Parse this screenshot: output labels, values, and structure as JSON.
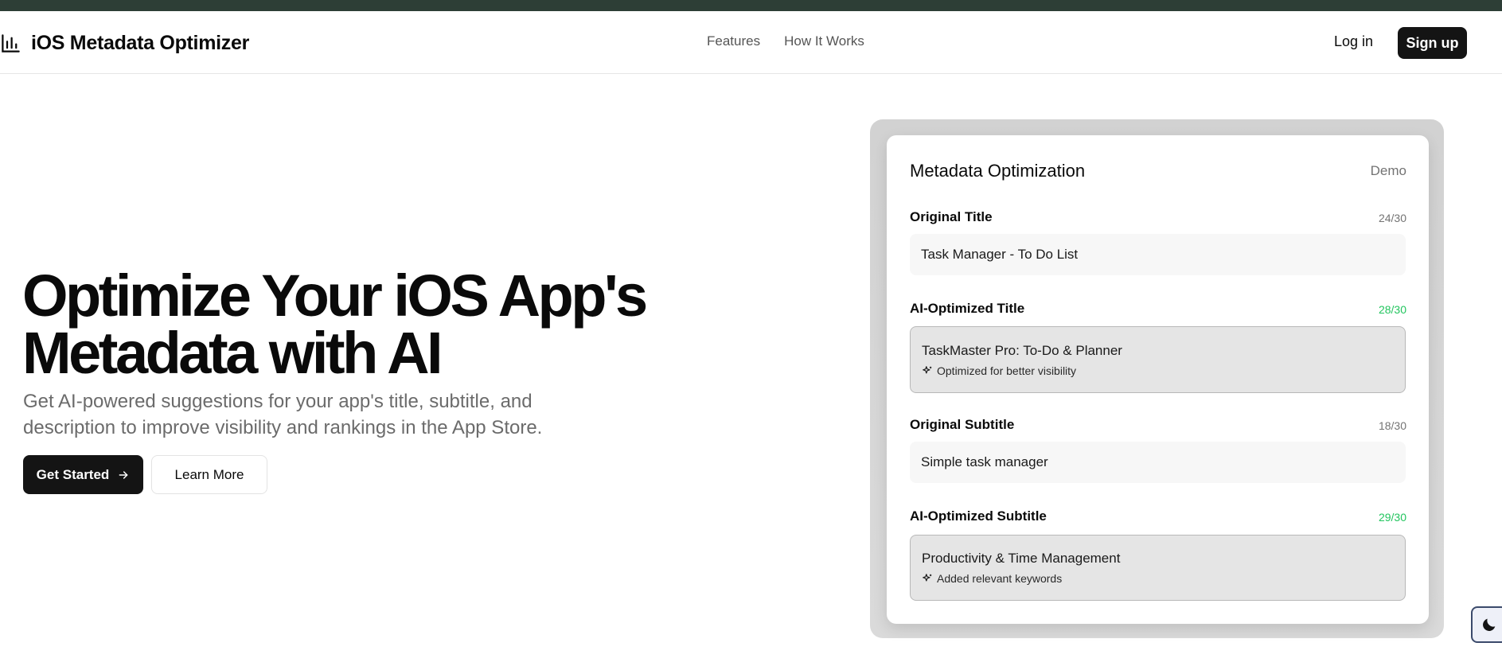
{
  "nav": {
    "brand_icon": "bar-chart-icon",
    "brand": "iOS Metadata Optimizer",
    "links": [
      "Features",
      "How It Works"
    ],
    "login": "Log in",
    "signup": "Sign up"
  },
  "hero": {
    "title": "Optimize Your iOS App's Metadata with AI",
    "subtitle": "Get AI-powered suggestions for your app's title, subtitle, and description to improve visibility and rankings in the App Store.",
    "primary_button": "Get Started",
    "primary_button_icon": "arrow-right-icon",
    "secondary_button": "Learn More"
  },
  "demo": {
    "title": "Metadata Optimization",
    "badge": "Demo",
    "fields": [
      {
        "label": "Original Title",
        "count": "24/30",
        "value": "Task Manager - To Do List"
      },
      {
        "label": "AI-Optimized Title",
        "count": "28/30",
        "value": "TaskMaster Pro: To-Do & Planner",
        "note": "Optimized for better visibility"
      },
      {
        "label": "Original Subtitle",
        "count": "18/30",
        "value": "Simple task manager"
      },
      {
        "label": "AI-Optimized Subtitle",
        "count": "29/30",
        "value": "Productivity & Time Management",
        "note": "Added relevant keywords"
      }
    ]
  },
  "theme_toggle_icon": "moon-icon",
  "colors": {
    "topbar": "#2d3e36",
    "primary": "#141414",
    "accent_green": "#22c55e",
    "muted_text": "#6b6b6b"
  }
}
